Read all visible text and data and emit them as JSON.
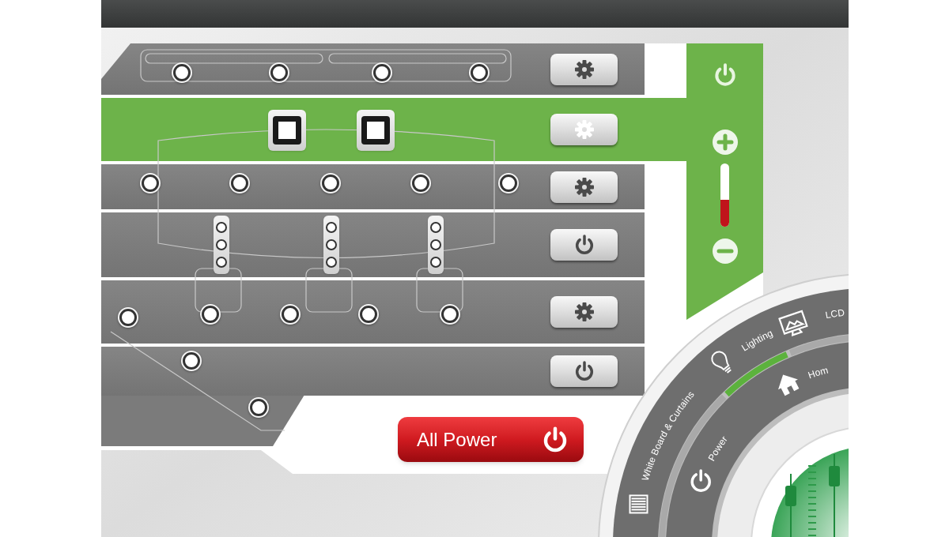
{
  "zones": [
    {
      "kind": "gear",
      "selected": false
    },
    {
      "kind": "gear",
      "selected": true
    },
    {
      "kind": "gear",
      "selected": false
    },
    {
      "kind": "power",
      "selected": false
    },
    {
      "kind": "gear",
      "selected": false
    },
    {
      "kind": "power",
      "selected": false
    }
  ],
  "volume": {
    "level": 0.42
  },
  "all_power": {
    "label": "All Power"
  },
  "dial": {
    "outer": [
      {
        "label": "White Board & Curtains",
        "kind": "blinds",
        "selected": false
      },
      {
        "label": "Lighting",
        "kind": "bulb",
        "selected": true
      },
      {
        "label": "LCD",
        "kind": "monitor",
        "selected": false
      }
    ],
    "inner": [
      {
        "label": "Power",
        "kind": "power"
      },
      {
        "label": "Hom",
        "kind": "house"
      }
    ]
  }
}
